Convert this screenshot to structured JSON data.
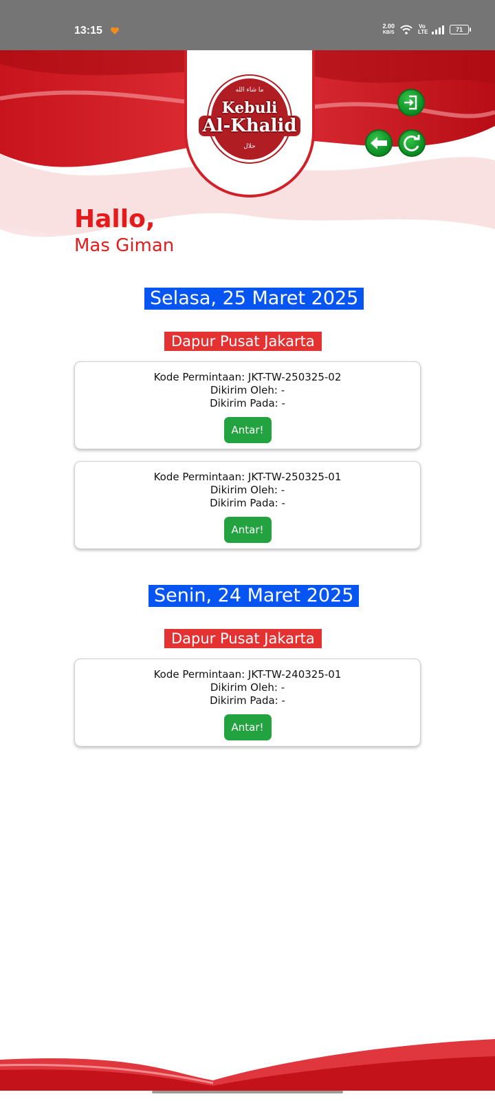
{
  "status_bar": {
    "time": "13:15",
    "network_speed_value": "2.00",
    "network_speed_unit": "KB/S",
    "volte": "Vo LTE",
    "battery": "71"
  },
  "app": {
    "brand_line1": "Kebuli",
    "brand_line2": "Al-Khalid",
    "brand_arabic_top": "ما شاء الله",
    "brand_arabic_bottom": "حلال",
    "accent_red": "#e41b1b",
    "accent_blue": "#0655f2",
    "accent_green": "#22a33f"
  },
  "greeting": {
    "hello": "Hallo,",
    "name": "Mas Giman"
  },
  "groups": [
    {
      "date": "Selasa, 25 Maret 2025",
      "kitchen": "Dapur Pusat Jakarta",
      "requests": [
        {
          "code": "Kode Permintaan: JKT-TW-250325-02",
          "sent_by": "Dikirim Oleh: -",
          "sent_at": "Dikirim Pada: -",
          "button": "Antar!"
        },
        {
          "code": "Kode Permintaan: JKT-TW-250325-01",
          "sent_by": "Dikirim Oleh: -",
          "sent_at": "Dikirim Pada: -",
          "button": "Antar!"
        }
      ]
    },
    {
      "date": "Senin, 24 Maret 2025",
      "kitchen": "Dapur Pusat Jakarta",
      "requests": [
        {
          "code": "Kode Permintaan: JKT-TW-240325-01",
          "sent_by": "Dikirim Oleh: -",
          "sent_at": "Dikirim Pada: -",
          "button": "Antar!"
        }
      ]
    }
  ],
  "icons": [
    "logout-icon",
    "back-arrow-icon",
    "refresh-icon"
  ]
}
